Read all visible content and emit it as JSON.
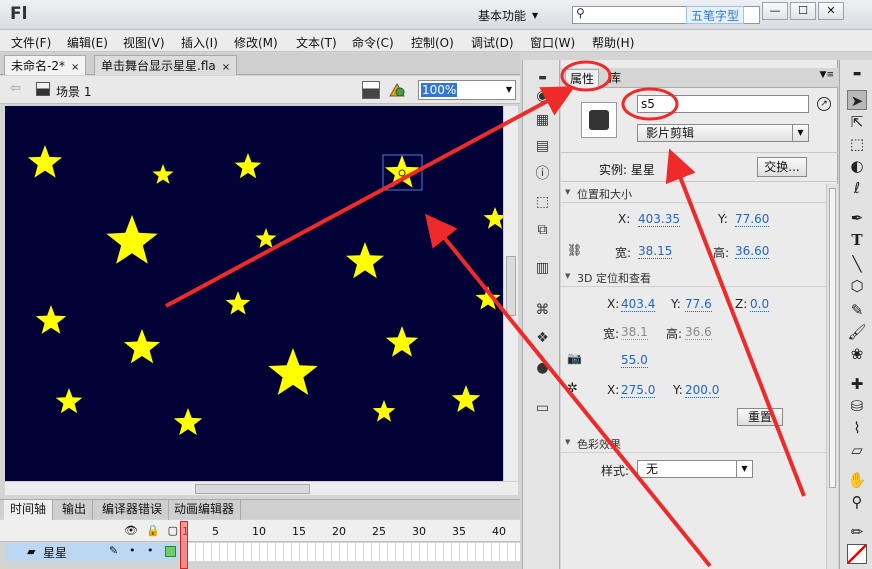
{
  "app": {
    "logo": "Fl",
    "workspace": "基本功能",
    "watermark": "五笔字型",
    "window_buttons": {
      "minimize": "—",
      "maximize": "☐",
      "close": "✕"
    }
  },
  "menu": [
    "文件(F)",
    "编辑(E)",
    "视图(V)",
    "插入(I)",
    "修改(M)",
    "文本(T)",
    "命令(C)",
    "控制(O)",
    "调试(D)",
    "窗口(W)",
    "帮助(H)"
  ],
  "doc_tabs": [
    {
      "label": "未命名-2*",
      "close": "×"
    },
    {
      "label": "单击舞台显示星星.fla",
      "close": "×"
    }
  ],
  "scene": {
    "label": "场景 1",
    "zoom": "100%"
  },
  "timeline": {
    "tabs": [
      "时间轴",
      "输出",
      "编译器错误",
      "动画编辑器"
    ],
    "frame_numbers": [
      "1",
      "5",
      "10",
      "15",
      "20",
      "25",
      "30",
      "35",
      "40"
    ],
    "layer_name": "星星"
  },
  "properties": {
    "tabs": [
      "属性",
      "库"
    ],
    "instance_name": "s5",
    "instance_type": "影片剪辑",
    "instance_label": "实例:  星星",
    "swap_button": "交换...",
    "position_section": "位置和大小",
    "x_label": "X:",
    "x_value": "403.35",
    "y_label": "Y:",
    "y_value": "77.60",
    "width_label": "宽:",
    "width_value": "38.15",
    "height_label": "高:",
    "height_value": "36.60",
    "section_3d": "3D 定位和查看",
    "x3d_label": "X:",
    "x3d_value": "403.4",
    "y3d_label": "Y:",
    "y3d_value": "77.6",
    "z3d_label": "Z:",
    "z3d_value": "0.0",
    "w3d_label": "宽:",
    "w3d_value": "38.1",
    "h3d_label": "高:",
    "h3d_value": "36.6",
    "perspective_value": "55.0",
    "vp_x_label": "X:",
    "vp_x_value": "275.0",
    "vp_y_label": "Y:",
    "vp_y_value": "200.0",
    "reset_button": "重置",
    "color_section": "色彩效果",
    "style_label": "样式:",
    "style_value": "无"
  },
  "colors": {
    "stage_background": "#020236",
    "star": "#ffff00",
    "annotation": "#ee2a2a",
    "selection": "#4a7fd8"
  }
}
